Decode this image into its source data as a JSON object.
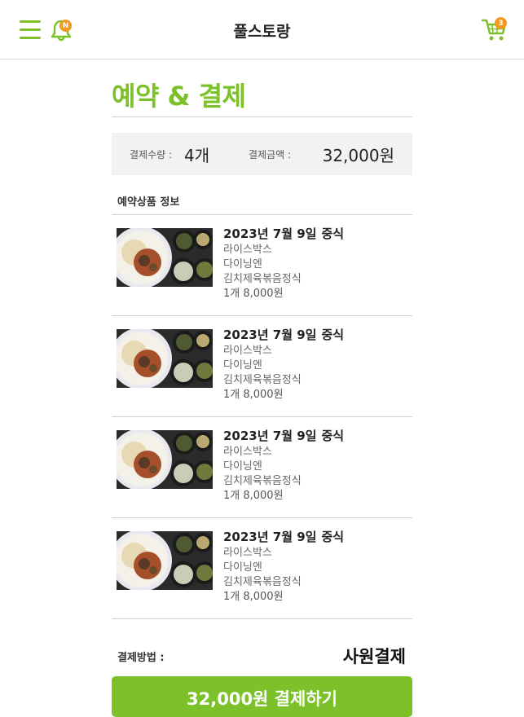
{
  "header": {
    "app_title": "풀스토랑",
    "notification_badge": "N",
    "cart_badge": "3",
    "icons": {
      "menu": "hamburger-menu-icon",
      "bell": "bell-icon",
      "cart": "cart-icon"
    },
    "colors": {
      "accent": "#7cc02a",
      "badge": "#f39a1e"
    }
  },
  "page": {
    "title": "예약 & 결제"
  },
  "summary": {
    "qty_label": "결제수량 :",
    "qty_value": "4개",
    "amount_label": "결제금액 :",
    "amount_value": "32,000원"
  },
  "section": {
    "label": "예약상품 정보"
  },
  "items": [
    {
      "date": "2023년 7월 9일",
      "category": "중식",
      "brand": "라이스박스",
      "place": "다이닝엔",
      "menu": "김치제육볶음정식",
      "qty_price": "1개  8,000원"
    },
    {
      "date": "2023년 7월 9일",
      "category": "중식",
      "brand": "라이스박스",
      "place": "다이닝엔",
      "menu": "김치제육볶음정식",
      "qty_price": "1개  8,000원"
    },
    {
      "date": "2023년 7월 9일",
      "category": "중식",
      "brand": "라이스박스",
      "place": "다이닝엔",
      "menu": "김치제육볶음정식",
      "qty_price": "1개  8,000원"
    },
    {
      "date": "2023년 7월 9일",
      "category": "중식",
      "brand": "라이스박스",
      "place": "다이닝엔",
      "menu": "김치제육볶음정식",
      "qty_price": "1개  8,000원"
    }
  ],
  "payment": {
    "method_label": "결제방법 :",
    "method_value": "사원결제",
    "button_label": "32,000원 결제하기"
  }
}
